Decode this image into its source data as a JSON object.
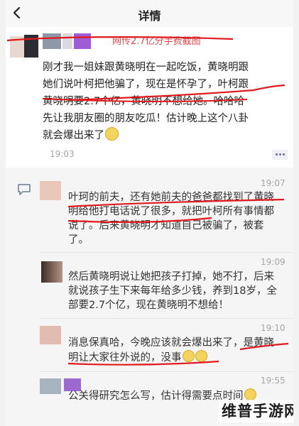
{
  "nav": {
    "title": "详情",
    "back_icon": "chevron-left-icon"
  },
  "watermark": "网传2.7亿分手费截图",
  "post": {
    "lines": [
      "刚才我一姐妹跟黄晓明在一起吃饭，黄晓明跟",
      "她们说叶柯把他骗了，现在是怀孕了，叶柯跟",
      "黄晓明要2.7个亿，黄晓明不想给她。哈哈哈",
      "先让我朋友圈的朋友吃瓜！估计晚上这个八卦",
      "就会爆出来了"
    ],
    "time": "19:03"
  },
  "comments": [
    {
      "time": "19:07",
      "lines": [
        "叶珂的前夫，还有她前夫的爸爸都找到了黄晓",
        "明给他打电话说了很多，就把叶柯所有事情都",
        "说了。后来黄晓明才知道自己被骗了，被套",
        "了。"
      ]
    },
    {
      "time": "19:09",
      "lines": [
        "然后黄晓明说让她把孩子打掉，她不打，后来",
        "就说孩子生下来每年给多少钱，养到18岁，全",
        "部要2.7个亿，现在黄晓明不想给！"
      ]
    },
    {
      "time": "19:10",
      "lines": [
        "消息保真哈，今晚应该就会爆出来了，是黄晓",
        "明让大家往外说的，没事"
      ]
    },
    {
      "time": "19:55",
      "lines": [
        "公关得研究怎么写，估计得需要点时间"
      ]
    }
  ],
  "logo": "维普手游网",
  "colors": {
    "highlight_red": "#e0191f",
    "time_gray": "#a5a5a5",
    "link_blue": "#5f6e91"
  }
}
